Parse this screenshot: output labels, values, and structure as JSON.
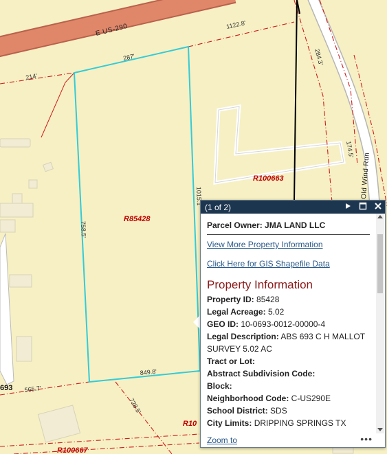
{
  "map": {
    "road_label": "E US-290",
    "street_label": "Old Wind Run",
    "dimensions": [
      "1122.8'",
      "287'",
      "214'",
      "284.3'",
      "174.5'",
      "1015.1'",
      "758.5'",
      "849.8'",
      "565.7'",
      "728.5'"
    ],
    "parcel_labels": [
      "R85428",
      "R100663",
      "R100667",
      "R10"
    ],
    "partial_labels": [
      "693"
    ],
    "colors": {
      "land": "#f6f0c4",
      "road": "#e0876a",
      "selected_parcel": "#34cbd6",
      "parcel_line": "#d01b1b",
      "parcel_label": "#c00000"
    }
  },
  "popup": {
    "title": "(1 of 2)",
    "header_icons": [
      "play-next-icon",
      "maximize-icon",
      "close-icon"
    ],
    "owner_label": "Parcel Owner:",
    "owner_value": "JMA LAND LLC",
    "link_more_info": "View More Property Information",
    "link_shapefile": "Click Here for GIS Shapefile Data",
    "section_title": "Property Information",
    "fields": [
      {
        "label": "Property ID:",
        "value": "85428"
      },
      {
        "label": "Legal Acreage:",
        "value": "5.02"
      },
      {
        "label": "GEO ID:",
        "value": "10-0693-0012-00000-4"
      },
      {
        "label": "Legal Description:",
        "value": "ABS 693 C H MALLOT SURVEY 5.02 AC"
      },
      {
        "label": "Tract or Lot:",
        "value": ""
      },
      {
        "label": "Abstract Subdivision Code:",
        "value": ""
      },
      {
        "label": "Block:",
        "value": ""
      },
      {
        "label": "Neighborhood Code:",
        "value": "C-US290E"
      },
      {
        "label": "School District:",
        "value": "SDS"
      },
      {
        "label": "City Limits:",
        "value": "DRIPPING SPRINGS TX"
      }
    ],
    "zoom_label": "Zoom to",
    "more_label": "•••"
  }
}
